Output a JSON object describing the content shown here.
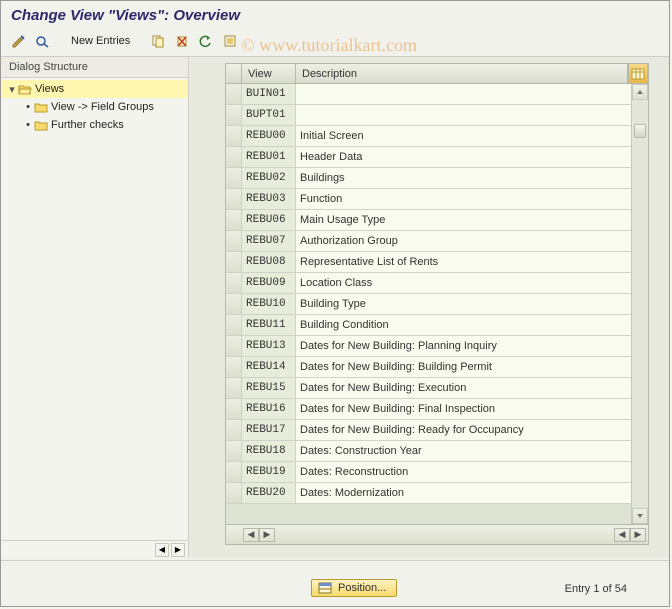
{
  "title": "Change View \"Views\": Overview",
  "toolbar": {
    "new_entries": "New Entries"
  },
  "watermark": "© www.tutorialkart.com",
  "sidebar": {
    "title": "Dialog Structure",
    "root": {
      "label": "Views",
      "expanded": true
    },
    "children": [
      {
        "label": "View -> Field Groups"
      },
      {
        "label": "Further checks"
      }
    ]
  },
  "grid": {
    "headers": {
      "view": "View",
      "desc": "Description"
    },
    "rows": [
      {
        "view": "BUIN01",
        "desc": ""
      },
      {
        "view": "BUPT01",
        "desc": ""
      },
      {
        "view": "REBU00",
        "desc": "Initial Screen"
      },
      {
        "view": "REBU01",
        "desc": "Header Data"
      },
      {
        "view": "REBU02",
        "desc": "Buildings"
      },
      {
        "view": "REBU03",
        "desc": "Function"
      },
      {
        "view": "REBU06",
        "desc": "Main Usage Type"
      },
      {
        "view": "REBU07",
        "desc": "Authorization Group"
      },
      {
        "view": "REBU08",
        "desc": "Representative List of Rents"
      },
      {
        "view": "REBU09",
        "desc": "Location Class"
      },
      {
        "view": "REBU10",
        "desc": "Building Type"
      },
      {
        "view": "REBU11",
        "desc": "Building Condition"
      },
      {
        "view": "REBU13",
        "desc": "Dates for New Building: Planning Inquiry"
      },
      {
        "view": "REBU14",
        "desc": "Dates for New Building: Building Permit"
      },
      {
        "view": "REBU15",
        "desc": "Dates for New Building: Execution"
      },
      {
        "view": "REBU16",
        "desc": "Dates for New Building: Final Inspection"
      },
      {
        "view": "REBU17",
        "desc": "Dates for New Building: Ready for Occupancy"
      },
      {
        "view": "REBU18",
        "desc": "Dates: Construction Year"
      },
      {
        "view": "REBU19",
        "desc": "Dates: Reconstruction"
      },
      {
        "view": "REBU20",
        "desc": "Dates: Modernization"
      }
    ]
  },
  "footer": {
    "position_label": "Position...",
    "entry_text": "Entry 1 of 54"
  }
}
